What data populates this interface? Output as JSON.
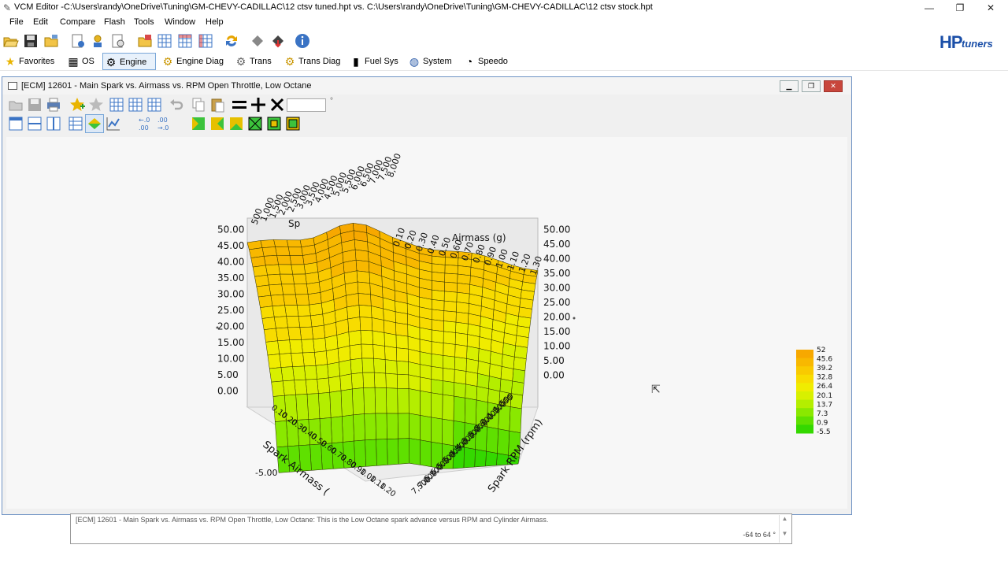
{
  "window": {
    "title": "VCM Editor -C:\\Users\\randy\\OneDrive\\Tuning\\GM-CHEVY-CADILLAC\\12 ctsv tuned.hpt vs. C:\\Users\\randy\\OneDrive\\Tuning\\GM-CHEVY-CADILLAC\\12 ctsv stock.hpt",
    "minimize": "—",
    "restore": "❐",
    "close": "✕"
  },
  "menu": [
    "File",
    "Edit",
    "Compare",
    "Flash",
    "Tools",
    "Window",
    "Help"
  ],
  "logo": {
    "hp": "HP",
    "tuners": "tuners"
  },
  "categories": [
    {
      "label": "Favorites",
      "icon": "star-icon",
      "glyph": "★",
      "color": "#e9b400"
    },
    {
      "label": "OS",
      "icon": "chip-icon",
      "glyph": "▦",
      "color": "#333333"
    },
    {
      "label": "Engine",
      "icon": "engine-icon",
      "glyph": "⚙",
      "color": "#333333"
    },
    {
      "label": "Engine Diag",
      "icon": "engine-diag-icon",
      "glyph": "⚙",
      "color": "#c99500"
    },
    {
      "label": "Trans",
      "icon": "gear-icon",
      "glyph": "⚙",
      "color": "#666666"
    },
    {
      "label": "Trans Diag",
      "icon": "trans-diag-icon",
      "glyph": "⚙",
      "color": "#c99500"
    },
    {
      "label": "Fuel Sys",
      "icon": "fuel-pump-icon",
      "glyph": "▮",
      "color": "#222222"
    },
    {
      "label": "System",
      "icon": "globe-icon",
      "glyph": "◍",
      "color": "#2a5aa8"
    },
    {
      "label": "Speedo",
      "icon": "speedometer-icon",
      "glyph": "◔",
      "color": "#333333"
    }
  ],
  "child": {
    "title": "[ECM] 12601 - Main Spark vs. Airmass vs. RPM Open Throttle, Low Octane",
    "minimize": "▁",
    "restore": "❐",
    "close": "✕",
    "value_input": "",
    "dot": "°"
  },
  "chart_data": {
    "type": "surface-3d",
    "title": "",
    "axis_top_left_partial": "Sp",
    "axis_top_right_partial": "Airmass (g)",
    "xlabel": "Spark Airmass (g)",
    "xlabel_visible": "Spark Airmass (",
    "ylabel": "Spark RPM (rpm)",
    "rpm_ticks": [
      "500",
      "1,000",
      "1,500",
      "2,000",
      "2,500",
      "3,000",
      "3,500",
      "4,000",
      "4,500",
      "5,000",
      "5,500",
      "6,000",
      "6,500",
      "7,000",
      "7,500",
      "8,000"
    ],
    "airmass_ticks": [
      "0.10",
      "0.20",
      "0.30",
      "0.40",
      "0.50",
      "0.60",
      "0.70",
      "0.80",
      "0.90",
      "1.00",
      "1.10",
      "1.20",
      "1.30"
    ],
    "airmass_front_ticks": [
      "0.10",
      "0.20",
      "0.30",
      "0.40",
      "0.50",
      "0.60",
      "0.70",
      "0.80",
      "0.90",
      "1.00",
      "1.10",
      "1.20"
    ],
    "z_ticks": [
      "0.00",
      "5.00",
      "10.00",
      "15.00",
      "20.00",
      "25.00",
      "30.00",
      "35.00",
      "40.00",
      "45.00",
      "50.00"
    ],
    "z_bottom_label": "-5.00",
    "zlim": [
      -5,
      52
    ],
    "legend": {
      "position": "right",
      "values": [
        "52",
        "45.6",
        "39.2",
        "32.8",
        "26.4",
        "20.1",
        "13.7",
        "7.3",
        "0.9",
        "-5.5"
      ],
      "colors": [
        "#f7a800",
        "#f8b800",
        "#f9ca00",
        "#f8dc00",
        "#f0ec00",
        "#d8f000",
        "#b4ee00",
        "#8ae800",
        "#5fe000",
        "#34d800"
      ]
    }
  },
  "status": {
    "description": "[ECM] 12601 - Main Spark vs. Airmass vs. RPM Open Throttle, Low Octane: This is the Low Octane spark advance versus RPM and Cylinder Airmass.",
    "range": "-64 to 64 °",
    "scroll_up": "▲",
    "scroll_down": "▼"
  },
  "cursor": "⇱"
}
